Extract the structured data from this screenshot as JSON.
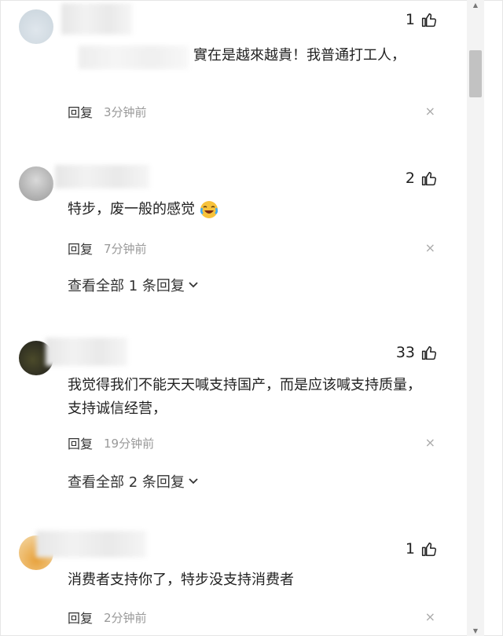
{
  "comments": [
    {
      "likes": "1",
      "text": "實在是越來越貴！我普通打工人，",
      "reply_label": "回复",
      "time": "3分钟前",
      "close": "×"
    },
    {
      "likes": "2",
      "text": "特步，废一般的感觉",
      "reply_label": "回复",
      "time": "7分钟前",
      "close": "×",
      "view_replies": "查看全部 1 条回复"
    },
    {
      "likes": "33",
      "text": "我觉得我们不能天天喊支持国产，而是应该喊支持质量，支持诚信经营，",
      "reply_label": "回复",
      "time": "19分钟前",
      "close": "×",
      "view_replies": "查看全部 2 条回复"
    },
    {
      "likes": "1",
      "text": "消费者支持你了，特步没支持消费者",
      "reply_label": "回复",
      "time": "2分钟前",
      "close": "×"
    }
  ],
  "scrollbar": {
    "up": "▲",
    "down": "▼"
  },
  "icons": {
    "like": "thumbs-up-icon",
    "chevron": "chevron-down-icon",
    "emoji": "laughing-crying-emoji-icon"
  }
}
